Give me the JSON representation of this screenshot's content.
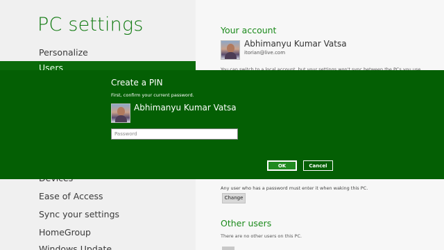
{
  "left": {
    "title": "PC settings",
    "items": [
      {
        "label": "Personalize"
      },
      {
        "label": "Users"
      },
      {
        "label": "Devices"
      },
      {
        "label": "Ease of Access"
      },
      {
        "label": "Sync your settings"
      },
      {
        "label": "HomeGroup"
      },
      {
        "label": "Windows Update"
      }
    ]
  },
  "right": {
    "account_title": "Your account",
    "account_name": "Abhimanyu Kumar Vatsa",
    "account_email": "itorian@live.com",
    "account_info": "You can switch to a local account, but your settings won't sync between the PCs you use.",
    "pin_info": "Any user who has a password must enter it when waking this PC.",
    "change_label": "Change",
    "other_users_title": "Other users",
    "other_users_info": "There are no other users on this PC."
  },
  "dialog": {
    "title": "Create a PIN",
    "subtitle": "First, confirm your current password.",
    "user_name": "Abhimanyu Kumar Vatsa",
    "password_placeholder": "Password",
    "ok_label": "OK",
    "cancel_label": "Cancel"
  },
  "colors": {
    "accent": "#117a11",
    "dialog_background": "#045f04",
    "ok_button": "#1f8a1f"
  }
}
